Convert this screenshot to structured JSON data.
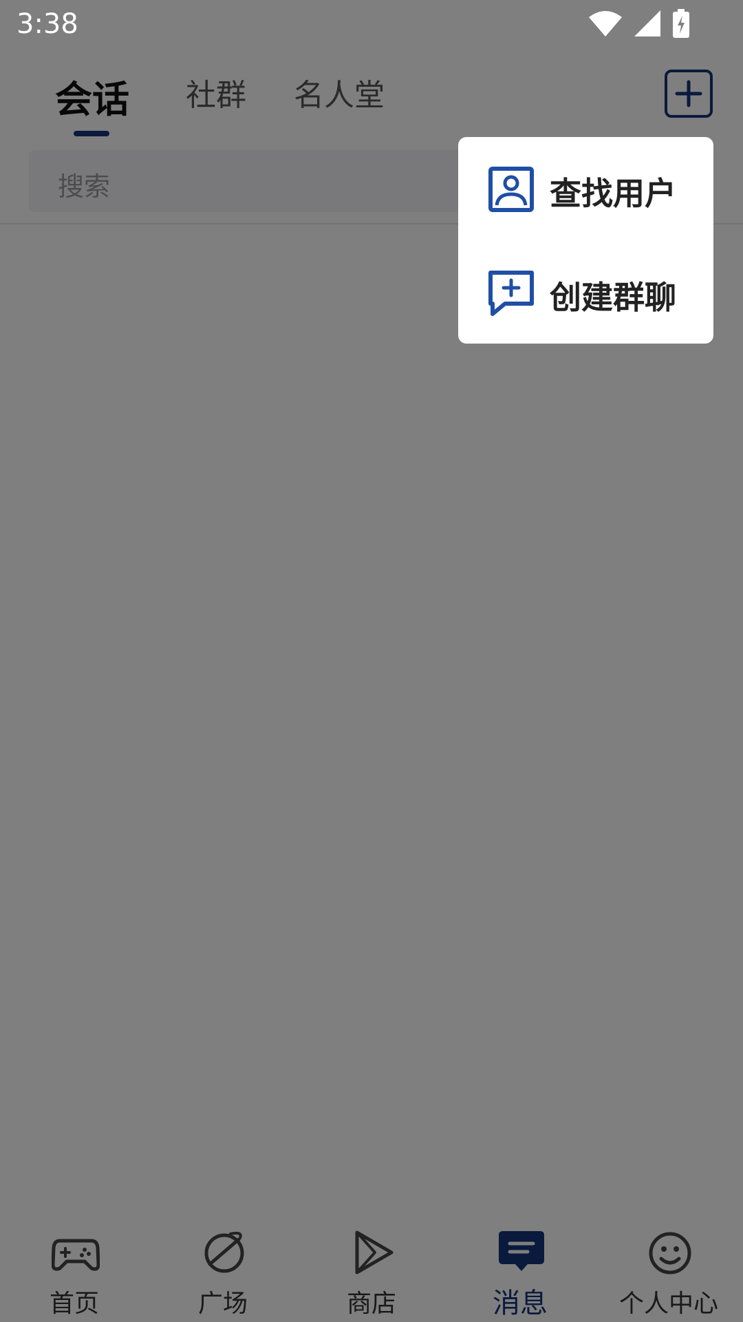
{
  "status_bar": {
    "time": "3:38"
  },
  "header": {
    "tabs": [
      {
        "label": "会话",
        "active": true
      },
      {
        "label": "社群",
        "active": false
      },
      {
        "label": "名人堂",
        "active": false
      }
    ]
  },
  "search": {
    "placeholder": "搜索"
  },
  "popup_menu": {
    "items": [
      {
        "label": "查找用户",
        "icon": "user-portrait-icon"
      },
      {
        "label": "创建群聊",
        "icon": "chat-add-icon"
      }
    ]
  },
  "bottom_nav": {
    "items": [
      {
        "label": "首页",
        "icon": "gamepad-icon",
        "active": false
      },
      {
        "label": "广场",
        "icon": "planet-icon",
        "active": false
      },
      {
        "label": "商店",
        "icon": "play-store-icon",
        "active": false
      },
      {
        "label": "消息",
        "icon": "message-icon",
        "active": true
      },
      {
        "label": "个人中心",
        "icon": "smiley-icon",
        "active": false
      }
    ]
  },
  "colors": {
    "accent": "#15357a",
    "icon_blue": "#1f4ea6",
    "overlay": "rgba(0,0,0,0.5)"
  }
}
